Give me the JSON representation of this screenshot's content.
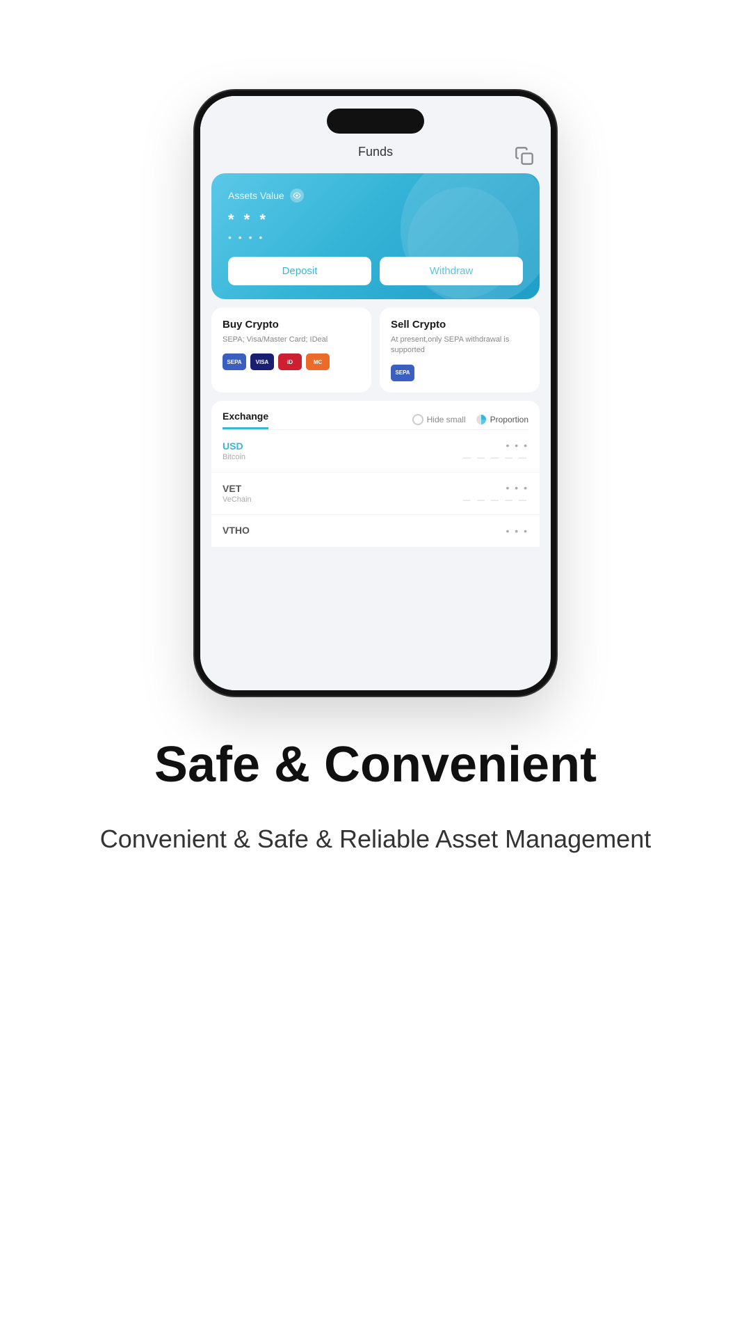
{
  "header": {
    "title": "Funds",
    "icon": "copy-icon"
  },
  "assets_card": {
    "label": "Assets Value",
    "value_hidden": "* * *",
    "sub_hidden": "• • • •",
    "deposit_label": "Deposit",
    "withdraw_label": "Withdraw"
  },
  "buy_crypto": {
    "title": "Buy Crypto",
    "description": "SEPA; Visa/Master Card; IDeal",
    "payments": [
      "SEPA",
      "VISA",
      "iD",
      "MC"
    ]
  },
  "sell_crypto": {
    "title": "Sell Crypto",
    "description": "At present,only SEPA withdrawal is supported",
    "payments": [
      "SEPA"
    ]
  },
  "exchange": {
    "tab_label": "Exchange",
    "hide_small_label": "Hide small",
    "proportion_label": "Proportion"
  },
  "assets": [
    {
      "name": "USD",
      "subtitle": "Bitcoin",
      "highlight": true
    },
    {
      "name": "VET",
      "subtitle": "VeChain",
      "highlight": false
    },
    {
      "name": "VTHO",
      "subtitle": "",
      "highlight": false
    }
  ],
  "marketing": {
    "title": "Safe & Convenient",
    "description": "Convenient & Safe & Reliable Asset Management"
  }
}
